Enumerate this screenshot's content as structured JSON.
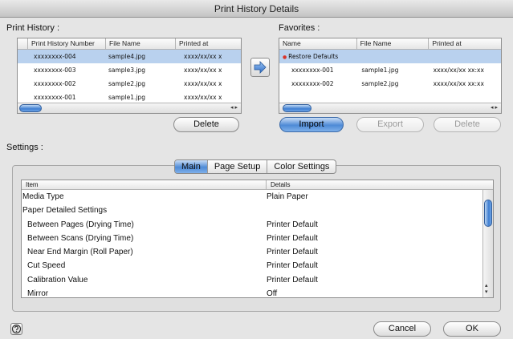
{
  "window": {
    "title": "Print History Details"
  },
  "print_history": {
    "label": "Print History :",
    "columns": [
      "Print History Number",
      "File Name",
      "Printed at"
    ],
    "rows": [
      {
        "number": "xxxxxxxx-004",
        "file": "sample4.jpg",
        "printed": "xxxx/xx/xx x",
        "selected": true
      },
      {
        "number": "xxxxxxxx-003",
        "file": "sample3.jpg",
        "printed": "xxxx/xx/xx x",
        "selected": false
      },
      {
        "number": "xxxxxxxx-002",
        "file": "sample2.jpg",
        "printed": "xxxx/xx/xx x",
        "selected": false
      },
      {
        "number": "xxxxxxxx-001",
        "file": "sample1.jpg",
        "printed": "xxxx/xx/xx x",
        "selected": false
      }
    ],
    "delete_label": "Delete"
  },
  "favorites": {
    "label": "Favorites :",
    "columns": [
      "Name",
      "File Name",
      "Printed at"
    ],
    "rows": [
      {
        "name": "Restore Defaults",
        "file": "",
        "printed": "",
        "selected": true
      },
      {
        "name": "xxxxxxxx-001",
        "file": "sample1.jpg",
        "printed": "xxxx/xx/xx xx:xx",
        "selected": false
      },
      {
        "name": "xxxxxxxx-002",
        "file": "sample2.jpg",
        "printed": "xxxx/xx/xx xx:xx",
        "selected": false
      }
    ],
    "import_label": "Import",
    "export_label": "Export",
    "delete_label": "Delete"
  },
  "settings": {
    "label": "Settings :",
    "tabs": [
      "Main",
      "Page Setup",
      "Color Settings"
    ],
    "active_tab": "Main",
    "columns": [
      "Item",
      "Details"
    ],
    "rows": [
      {
        "item": "Media Type",
        "details": "Plain Paper"
      },
      {
        "item": "Paper Detailed Settings",
        "details": ""
      },
      {
        "item": "  Between Pages (Drying Time)",
        "details": "Printer Default"
      },
      {
        "item": "  Between Scans (Drying Time)",
        "details": "Printer Default"
      },
      {
        "item": "  Near End Margin (Roll Paper)",
        "details": "Printer Default"
      },
      {
        "item": "  Cut Speed",
        "details": "Printer Default"
      },
      {
        "item": "  Calibration Value",
        "details": "Printer Default"
      },
      {
        "item": "  Mirror",
        "details": "Off"
      }
    ]
  },
  "footer": {
    "cancel_label": "Cancel",
    "ok_label": "OK",
    "help_icon": "help-icon"
  },
  "colors": {
    "selection": "#b9d1ee",
    "accent": "#4e8ad6"
  }
}
